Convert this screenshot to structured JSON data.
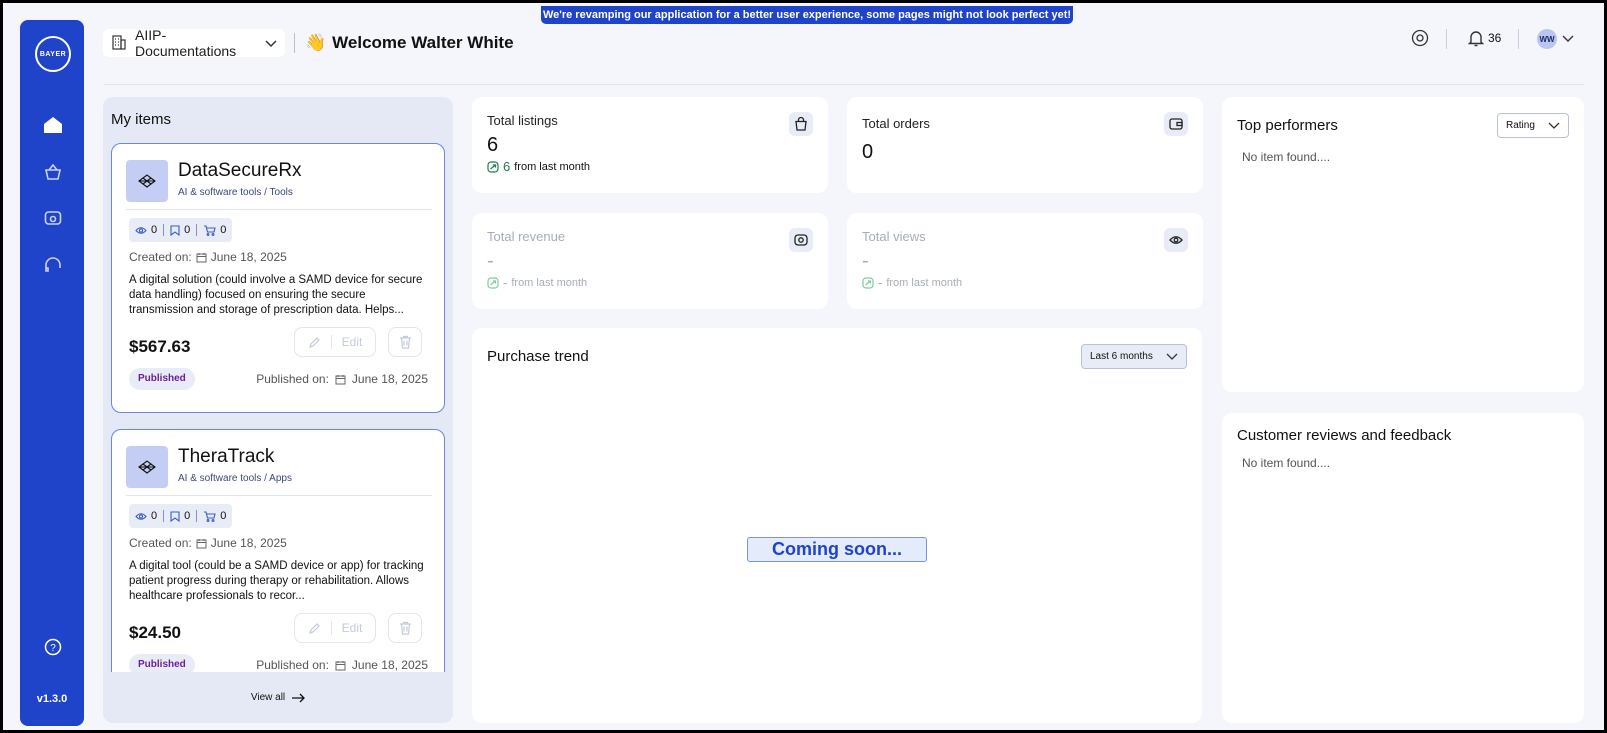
{
  "banner": "We're revamping our application for a better user experience, some pages might not look perfect yet!",
  "sidebar": {
    "logo_text": "BAYER",
    "version": "v1.3.0"
  },
  "header": {
    "org": "AIIP-Documentations",
    "welcome_emoji": "👋",
    "welcome": "Welcome Walter White",
    "notification_count": "36",
    "avatar_initials": "WW"
  },
  "my_items": {
    "title": "My items",
    "view_all": "View all",
    "items": [
      {
        "name": "DataSecureRx",
        "category": "AI & software tools / Tools",
        "views": "0",
        "saves": "0",
        "cart": "0",
        "created_label": "Created on:",
        "created": "June 18, 2025",
        "description": "A digital solution (could involve a SAMD device for secure data handling) focused on ensuring the secure transmission and storage of prescription data. Helps...",
        "price": "$567.63",
        "edit": "Edit",
        "status": "Published",
        "published_label": "Published on:",
        "published": "June 18, 2025"
      },
      {
        "name": "TheraTrack",
        "category": "AI & software tools / Apps",
        "views": "0",
        "saves": "0",
        "cart": "0",
        "created_label": "Created on:",
        "created": "June 18, 2025",
        "description": "A digital tool (could be a SAMD device or app) for tracking patient progress during therapy or rehabilitation. Allows healthcare professionals to recor...",
        "price": "$24.50",
        "edit": "Edit",
        "status": "Published",
        "published_label": "Published on:",
        "published": "June 18, 2025"
      }
    ]
  },
  "stats": {
    "listings": {
      "label": "Total listings",
      "value": "6",
      "delta": "6",
      "delta_text": "from last month",
      "icon": "bag-icon"
    },
    "orders": {
      "label": "Total orders",
      "value": "0",
      "icon": "wallet-icon"
    },
    "revenue": {
      "label": "Total revenue",
      "value": "-",
      "delta": "-",
      "delta_text": "from last month",
      "icon": "money-icon"
    },
    "views": {
      "label": "Total views",
      "value": "-",
      "delta": "-",
      "delta_text": "from last month",
      "icon": "eye-icon"
    }
  },
  "purchase_trend": {
    "title": "Purchase trend",
    "range": "Last 6 months",
    "placeholder": "Coming soon..."
  },
  "top_performers": {
    "title": "Top performers",
    "sort": "Rating",
    "empty": "No item found...."
  },
  "reviews": {
    "title": "Customer reviews and feedback",
    "empty": "No item found...."
  },
  "colors": {
    "brand": "#1f44c9",
    "published": "#6b1f9a",
    "positive": "#18804a"
  }
}
